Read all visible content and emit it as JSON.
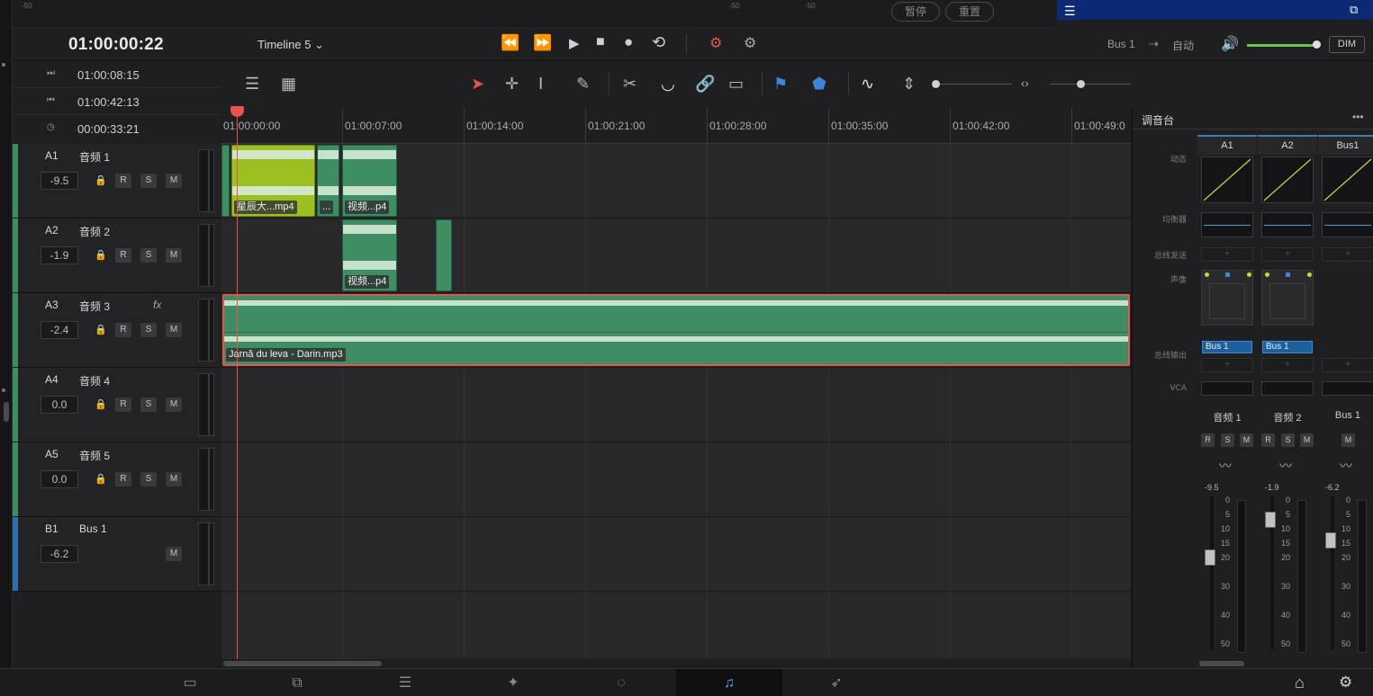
{
  "meters": {
    "minus50": "-50"
  },
  "meter_buttons": {
    "pause": "暂停",
    "reset": "重置"
  },
  "topbar": {
    "timecode": "01:00:00:22",
    "timeline_name": "Timeline 5",
    "bus_label": "Bus 1",
    "auto_label": "自动",
    "dim_label": "DIM",
    "chevron": "⌄",
    "arrow": "⇢"
  },
  "transport": {
    "rewind": "⏪",
    "forward": "⏩",
    "play": "▶",
    "stop": "■",
    "record": "●",
    "loop": "⟲"
  },
  "timecodes": [
    {
      "icon": "⏭",
      "value": "01:00:08:15"
    },
    {
      "icon": "⏮",
      "value": "01:00:42:13"
    },
    {
      "icon": "◷",
      "value": "00:00:33:21"
    }
  ],
  "ruler": [
    "01:00:00:00",
    "01:00:07:00",
    "01:00:14:00",
    "01:00:21:00",
    "01:00:28:00",
    "01:00:35:00",
    "01:00:42:00",
    "01:00:49:0"
  ],
  "tracks": [
    {
      "id": "A1",
      "name": "音频 1",
      "volume": "-9.5",
      "color": "#3c8f5f"
    },
    {
      "id": "A2",
      "name": "音频 2",
      "volume": "-1.9",
      "color": "#3c8f5f"
    },
    {
      "id": "A3",
      "name": "音频 3",
      "volume": "-2.4",
      "color": "#3c8f5f",
      "fx": "fx"
    },
    {
      "id": "A4",
      "name": "音频 4",
      "volume": "0.0",
      "color": "#3c8f5f"
    },
    {
      "id": "A5",
      "name": "音频 5",
      "volume": "0.0",
      "color": "#3c8f5f"
    },
    {
      "id": "B1",
      "name": "Bus 1",
      "volume": "-6.2",
      "color": "#2f6fae"
    }
  ],
  "track_buttons": {
    "r": "R",
    "s": "S",
    "m": "M"
  },
  "clips": {
    "a1_clip1": "星辰大...mp4",
    "a1_clip2": "...",
    "a1_clip3": "视频...p4",
    "a2_clip1": "视频...p4",
    "a3_clip1": "Jarnă du leva - Darin.mp3"
  },
  "mixer": {
    "title": "调音台",
    "more": "•••",
    "row_labels": {
      "dynamics": "动态",
      "eq": "均衡器",
      "bus_send": "总线发送",
      "pan": "声像",
      "bus_out": "总线输出",
      "vca": "VCA"
    },
    "channels": [
      {
        "head": "A1",
        "name": "音频 1",
        "fader": "-9.5",
        "bus_out": "Bus 1",
        "fader_level_db": -20
      },
      {
        "head": "A2",
        "name": "音频 2",
        "fader": "-1.9",
        "bus_out": "Bus 1",
        "fader_level_db": -7
      },
      {
        "head": "Bus1",
        "name": "Bus 1",
        "fader": "-6.2",
        "bus_out": "",
        "fader_level_db": -14
      }
    ],
    "scale": [
      "0",
      "5",
      "10",
      "15",
      "20",
      "30",
      "40",
      "50"
    ],
    "plus": "+"
  },
  "pages": [
    {
      "name": "media",
      "icon": "▭"
    },
    {
      "name": "cut",
      "icon": "⧉"
    },
    {
      "name": "edit",
      "icon": "☰"
    },
    {
      "name": "fusion",
      "icon": "✦"
    },
    {
      "name": "color",
      "icon": "◌"
    },
    {
      "name": "fairlight",
      "icon": "♫"
    },
    {
      "name": "deliver",
      "icon": "➶"
    }
  ],
  "bottom_right": {
    "home": "⌂",
    "settings": "⚙"
  }
}
